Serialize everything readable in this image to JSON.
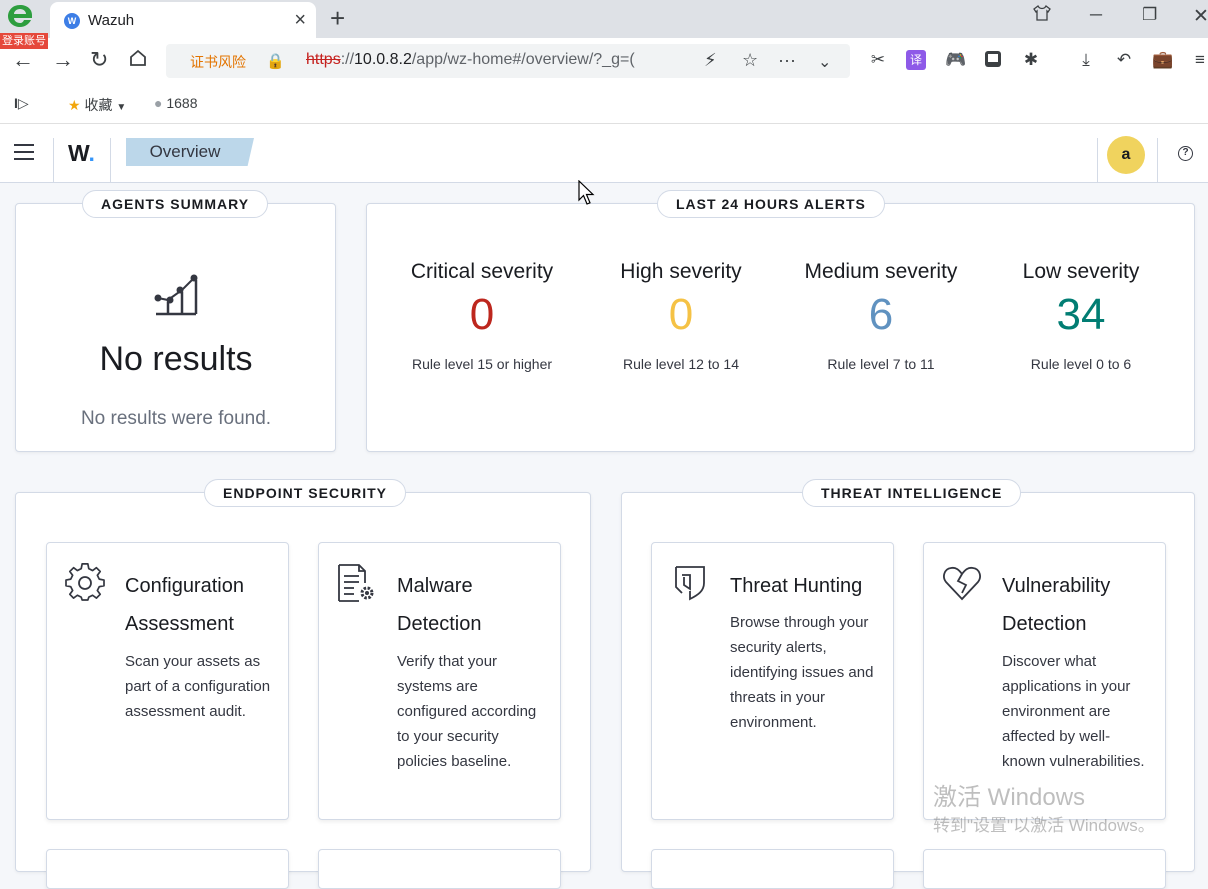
{
  "browser": {
    "login_badge": "登录账号",
    "tab_title": "Wazuh",
    "tab_favicon": "W",
    "new_tab": "+",
    "cert_warning": "证书风险",
    "url_protocol": "https",
    "url_sep": "://",
    "url_host": "10.0.8.2",
    "url_path": "/app/wz-home#/overview/?_g=(",
    "bookmarks": [
      {
        "label": "收藏",
        "icon": "star-icon"
      },
      {
        "label": "1688",
        "icon": "globe-icon"
      }
    ]
  },
  "app": {
    "logo_text": "W",
    "logo_dot": ".",
    "breadcrumb": "Overview",
    "user_initial": "a",
    "help": "?"
  },
  "agents_summary": {
    "title": "AGENTS SUMMARY",
    "empty_title": "No results",
    "empty_message": "No results were found."
  },
  "alerts": {
    "title": "LAST 24 HOURS ALERTS",
    "stats": [
      {
        "title": "Critical severity",
        "value": "0",
        "desc": "Rule level 15 or higher",
        "color": "#bd271e"
      },
      {
        "title": "High severity",
        "value": "0",
        "desc": "Rule level 12 to 14",
        "color": "#f5c245"
      },
      {
        "title": "Medium severity",
        "value": "6",
        "desc": "Rule level 7 to 11",
        "color": "#6092c0"
      },
      {
        "title": "Low severity",
        "value": "34",
        "desc": "Rule level 0 to 6",
        "color": "#017d73"
      }
    ]
  },
  "endpoint_security": {
    "title": "ENDPOINT SECURITY",
    "cards": [
      {
        "title": "Configuration Assessment",
        "desc": "Scan your assets as part of a configuration assessment audit.",
        "icon": "gear-icon"
      },
      {
        "title": "Malware Detection",
        "desc": "Verify that your systems are configured according to your security policies baseline.",
        "icon": "document-gear-icon"
      }
    ]
  },
  "threat_intelligence": {
    "title": "THREAT INTELLIGENCE",
    "cards": [
      {
        "title": "Threat Hunting",
        "desc": "Browse through your security alerts, identifying issues and threats in your environment.",
        "icon": "shield-icon"
      },
      {
        "title": "Vulnerability Detection",
        "desc": "Discover what applications in your environment are affected by well-known vulnerabilities.",
        "icon": "heart-icon"
      }
    ]
  },
  "watermark": {
    "line1": "激活 Windows",
    "line2": "转到\"设置\"以激活 Windows。"
  }
}
